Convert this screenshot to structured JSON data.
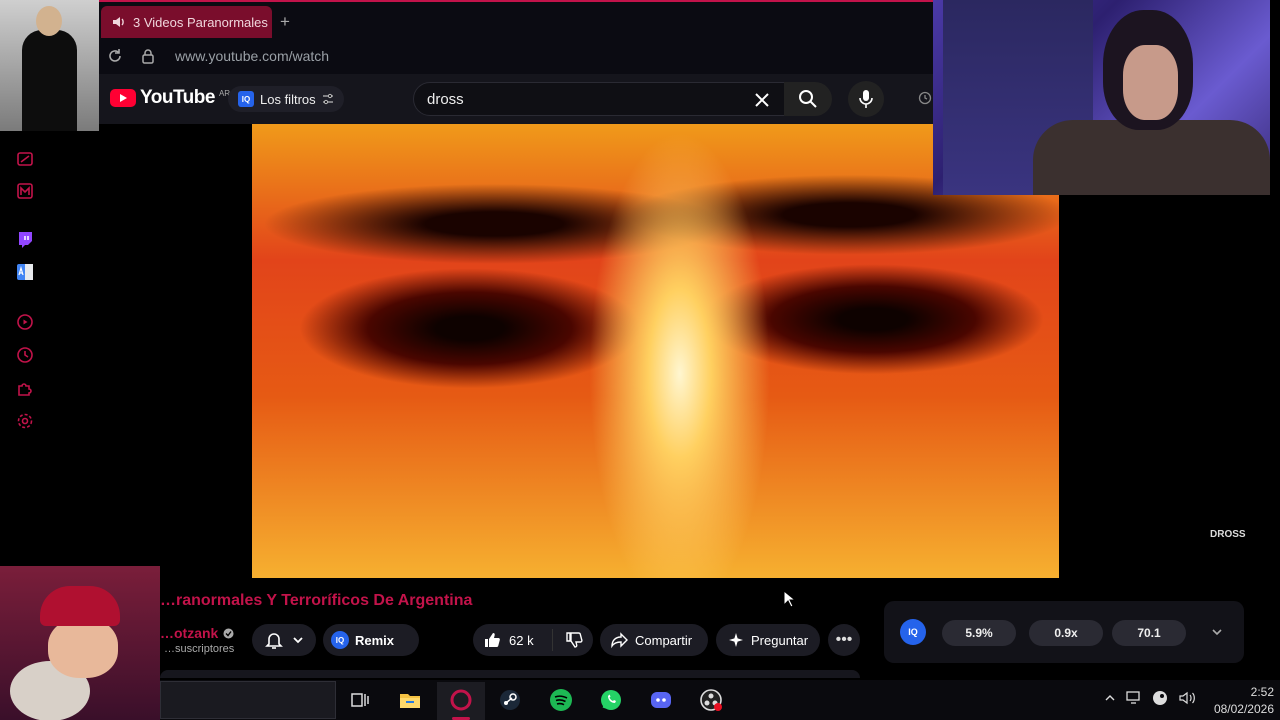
{
  "browser": {
    "tab_title": "3 Videos Paranormales",
    "new_tab_symbol": "+",
    "url": "www.youtube.com/watch"
  },
  "youtube": {
    "logo_text": "YouTube",
    "country_code": "AR",
    "filters_label": "Los filtros",
    "search_value": "dross"
  },
  "video": {
    "watermark": "DROSS",
    "title": "…ranormales Y Terroríficos De Argentina",
    "channel": "…otzank",
    "subscribers": "…suscriptores",
    "remix_label": "Remix",
    "likes": "62 k",
    "share_label": "Compartir",
    "ask_label": "Preguntar",
    "more_label": "•••"
  },
  "stats_panel": {
    "badge": "IQ",
    "values": [
      "5.9%",
      "0.9x",
      "70.1"
    ]
  },
  "taskbar": {
    "time": "2:52",
    "date": "08/02/2026"
  },
  "colors": {
    "accent": "#c2134a",
    "tab_bg": "#7a0d2c",
    "iq_blue": "#2563eb"
  }
}
